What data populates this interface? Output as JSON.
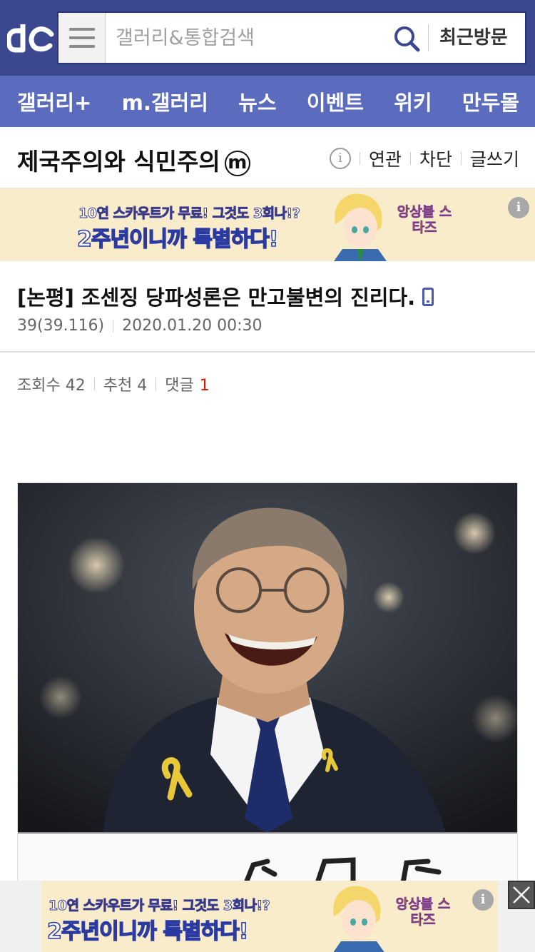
{
  "header": {
    "search_placeholder": "갤러리&통합검색",
    "recent_label": "최근방문"
  },
  "nav": {
    "items": [
      "갤러리+",
      "m.갤러리",
      "뉴스",
      "이벤트",
      "위키",
      "만두몰"
    ]
  },
  "gallery": {
    "title": "제국주의와 식민주의",
    "badge": "m",
    "actions": [
      "연관",
      "차단",
      "글쓰기"
    ]
  },
  "ad": {
    "line1": "10연 스카우트가 무료! 그것도 3회나!?",
    "line2": "2주년이니까 특별하다!",
    "logo": "앙상블 스타즈",
    "info": "i"
  },
  "post": {
    "title": "[논평] 조센징 당파성론은 만고불변의 진리다.",
    "author": "39(39.116)",
    "date": "2020.01.20 00:30",
    "views_label": "조회수 42",
    "recommend_label": "추천 4",
    "reply_label": "댓글",
    "reply_count": "1"
  },
  "colors": {
    "header_bg": "#3b4890",
    "nav_bg": "#5b6bbd",
    "reply_accent": "#d31900"
  }
}
